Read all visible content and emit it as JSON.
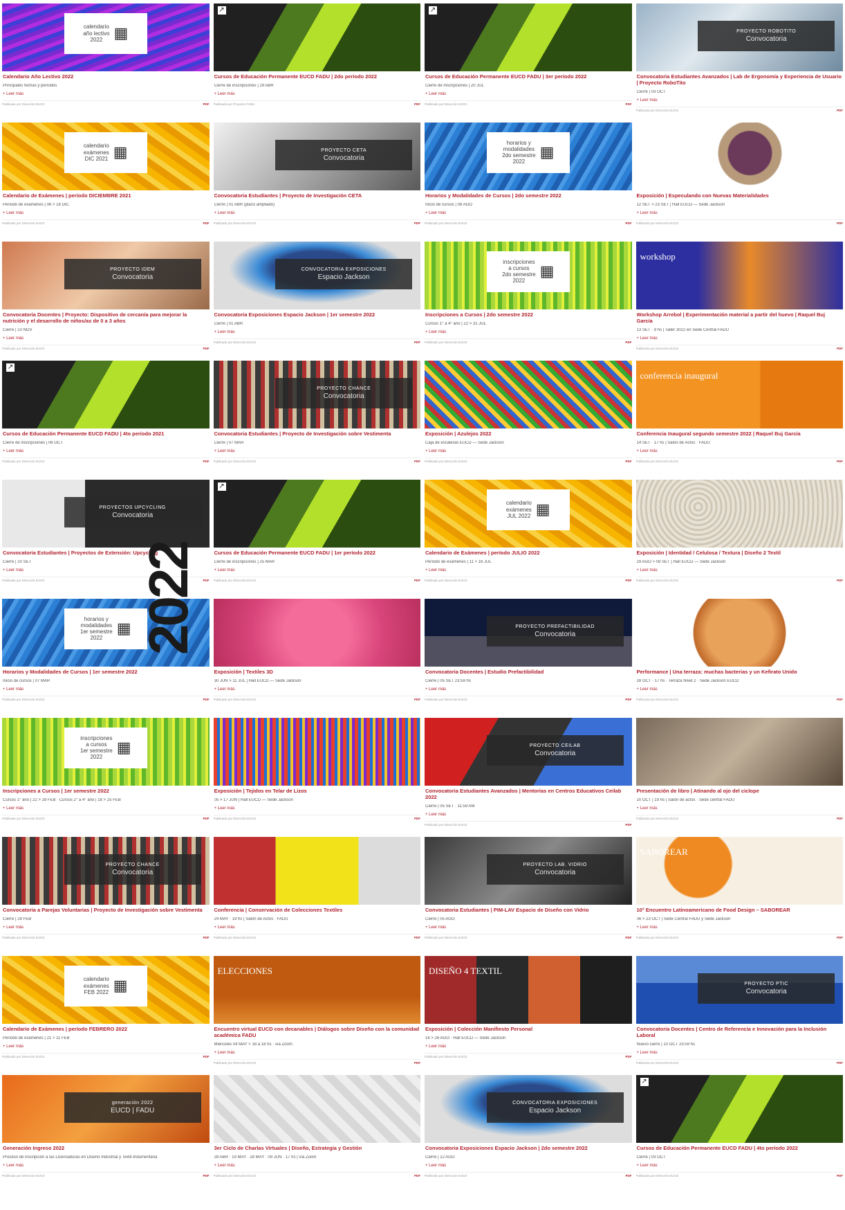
{
  "year_label": "2022",
  "columns": [
    [
      {
        "theme": "t-purple",
        "box": "calendario\naño lectivo\n2022",
        "title": "Calendario Año Lectivo 2022",
        "sub": "Principales fechas y períodos",
        "more": "+ Leer más",
        "meta": "Publicado por Dirección EUCD"
      },
      {
        "theme": "t-yellow",
        "box": "calendario\nexámenes\nDIC 2021",
        "title": "Calendario de Exámenes | período DICIEMBRE 2021",
        "sub": "Período de exámenes | 06 > 18 DIC",
        "more": "+ Leer más",
        "meta": "Publicado por Dirección EUCD"
      },
      {
        "theme": "t-idem",
        "bar": "PROYECTO IDEM",
        "bar2": "Convocatoria",
        "title": "Convocatoria Docentes | Proyecto: Dispositivo de cercanía para mejorar la nutrición y el desarrollo de niños/as de 0 a 3 años",
        "sub": "Cierre | 10 NOV",
        "more": "+ Leer más",
        "meta": "Publicado por Dirección EUCD"
      },
      {
        "theme": "t-green",
        "corner": true,
        "title": "Cursos de Educación Permanente EUCD FADU | 4to período 2021",
        "sub": "Cierre de inscripciones | 06 OCT",
        "more": "+ Leer más",
        "meta": "Publicado por Dirección EUCD"
      },
      {
        "theme": "t-upcycling",
        "bar": "PROYECTOS UPCYCLING",
        "bar2": "Convocatoria",
        "title": "Convocatoria Estudiantes | Proyectos de Extensión: Upcycling",
        "sub": "Cierre | 20 SET",
        "more": "+ Leer más",
        "meta": "Publicado por Dirección EUCD"
      },
      {
        "theme": "t-blue",
        "box": "horarios y\nmodalidades\n1er semestre\n2022",
        "title": "Horarios y Modalidades de Cursos | 1er semestre 2022",
        "sub": "Inicio de cursos | 07 MAR",
        "more": "+ Leer más",
        "meta": "Publicado por Dirección EUCD"
      },
      {
        "theme": "t-lime",
        "box": "inscripciones\na cursos\n1er semestre\n2022",
        "title": "Inscripciones a Cursos | 1er semestre 2022",
        "sub": "Cursos 1° año | 22 > 28 FEB · Cursos 2° a 4° año | 18 > 25 FEB",
        "more": "+ Leer más",
        "meta": "Publicado por Dirección EUCD"
      },
      {
        "theme": "t-clothes",
        "bar": "PROYECTO CHANCE",
        "bar2": "Convocatoria",
        "title": "Convocatoria a Parejas Voluntarias | Proyecto de Investigación sobre Vestimenta",
        "sub": "Cierre | 28 FEB",
        "more": "+ Leer más",
        "meta": "Publicado por Dirección EUCD"
      },
      {
        "theme": "t-yellow",
        "box": "calendario\nexámenes\nFEB 2022",
        "title": "Calendario de Exámenes | período FEBRERO 2022",
        "sub": "Período de exámenes | 21 > 11 FEB",
        "more": "+ Leer más",
        "meta": "Publicado por Dirección EUCD"
      },
      {
        "theme": "t-gen",
        "bar": "generación 2022",
        "bar2": "EUCD | FADU",
        "title": "Generación Ingreso 2022",
        "sub": "Proceso de inscripción a las Licenciaturas en Diseño Industrial y Textil-Indumentaria",
        "more": "+ Leer más",
        "meta": "Publicado por Dirección EUCD"
      }
    ],
    [
      {
        "theme": "t-green",
        "corner": true,
        "title": "Cursos de Educación Permanente EUCD FADU | 2do período 2022",
        "sub": "Cierre de inscripciones | 29 ABR",
        "more": "+ Leer más",
        "meta": "Publicado por Proyecto FADU"
      },
      {
        "theme": "t-ceta",
        "bar": "PROYECTO CETA",
        "bar2": "Convocatoria",
        "title": "Convocatoria Estudiantes | Proyecto de Investigación CETA",
        "sub": "Cierre | 01 ABR (plazo ampliado)",
        "more": "+ Leer más",
        "meta": "Publicado por Dirección EUCD"
      },
      {
        "theme": "t-glass",
        "bar": "CONVOCATORIA EXPOSICIONES",
        "bar2": "Espacio Jackson",
        "title": "Convocatoria Exposiciones Espacio Jackson | 1er semestre 2022",
        "sub": "Cierre | 01 ABR",
        "more": "+ Leer más",
        "meta": "Publicado por Dirección EUCD"
      },
      {
        "theme": "t-clothes",
        "bar": "PROYECTO CHANCE",
        "bar2": "Convocatoria",
        "title": "Convocatoria Estudiantes | Proyecto de Investigación sobre Vestimenta",
        "sub": "Cierre | 07 MAR",
        "more": "+ Leer más",
        "meta": "Publicado por Dirección EUCD"
      },
      {
        "theme": "t-green",
        "corner": true,
        "title": "Cursos de Educación Permanente EUCD FADU | 1er período 2022",
        "sub": "Cierre de inscripciones | 25 MAR",
        "more": "+ Leer más",
        "meta": "Publicado por Dirección EUCD"
      },
      {
        "theme": "t-pink",
        "title": "Exposición | Textiles 3D",
        "sub": "30 JUN > 11 JUL | Hall EUCD — Sede Jackson",
        "more": "+ Leer más",
        "meta": "Publicado por Dirección EUCD"
      },
      {
        "theme": "t-weave",
        "title": "Exposición | Tejidos en Telar de Lizos",
        "sub": "05 > 17 JUN | Hall EUCD — Sede Jackson",
        "more": "+ Leer más",
        "meta": "Publicado por Dirección EUCD"
      },
      {
        "theme": "t-textiles",
        "title": "Conferencia | Conservación de Colecciones Textiles",
        "sub": "24 MAY · 19 hs | Salón de Actos · FADU",
        "more": "+ Leer más",
        "meta": "Publicado por Dirección EUCD"
      },
      {
        "theme": "t-elecc",
        "big": "ELECCIONES",
        "title": "Encuentro virtual EUCD con decanables | Diálogos sobre Diseño con la comunidad académica FADU",
        "sub": "Miércoles 04 MAY > 18 a 18 hs · vía Zoom",
        "more": "+ Leer más",
        "meta": "Publicado por Dirección EUCD"
      },
      {
        "theme": "t-puzzle",
        "title": "3er Ciclo de Charlas Virtuales | Diseño, Estrategia y Gestión",
        "sub": "28 ABR · 19 MAY · 28 MAY · 09 JUN · 17 hs | vía Zoom",
        "more": "+ Leer más",
        "meta": "Publicado por Dirección EUCD"
      }
    ],
    [
      {
        "theme": "t-green",
        "corner": true,
        "title": "Cursos de Educación Permanente EUCD FADU | 3er período 2022",
        "sub": "Cierre de inscripciones | 20 JUL",
        "more": "+ Leer más",
        "meta": "Publicado por Dirección EUCD"
      },
      {
        "theme": "t-blue",
        "box": "horarios y\nmodalidades\n2do semestre\n2022",
        "title": "Horarios y Modalidades de Cursos | 2do semestre 2022",
        "sub": "Inicio de cursos | 08 AGO",
        "more": "+ Leer más",
        "meta": "Publicado por Dirección EUCD"
      },
      {
        "theme": "t-lime",
        "box": "inscripciones\na cursos\n2do semestre\n2022",
        "title": "Inscripciones a Cursos | 2do semestre 2022",
        "sub": "Cursos 1° a 4° año | 22 > 31 JUL",
        "more": "+ Leer más",
        "meta": "Publicado por Dirección EUCD"
      },
      {
        "theme": "t-tiles",
        "title": "Exposición | Azulejos 2022",
        "sub": "Caja de escaleras EUCD — Sede Jackson",
        "more": "+ Leer más",
        "meta": "Publicado por Dirección EUCD"
      },
      {
        "theme": "t-yellow",
        "box": "calendario\nexámenes\nJUL 2022",
        "title": "Calendario de Exámenes | período JULIO 2022",
        "sub": "Período de exámenes | 11 > 16 JUL",
        "more": "+ Leer más",
        "meta": "Publicado por Dirección EUCD"
      },
      {
        "theme": "t-night",
        "bar": "PROYECTO PREFACTIBILIDAD",
        "bar2": "Convocatoria",
        "title": "Convocatoria Docentes | Estudio Prefactibilidad",
        "sub": "Cierre | 05 SET 23:59 hs",
        "more": "+ Leer más",
        "meta": "Publicado por Dirección EUCD"
      },
      {
        "theme": "t-tape",
        "bar": "PROYECTO CEILAB",
        "bar2": "Convocatoria",
        "title": "Convocatoria Estudiantes Avanzados | Mentorías en Centros Educativos Ceilab 2022",
        "sub": "Cierre | 05 SET · 11:59 AM",
        "more": "+ Leer más",
        "meta": "Publicado por Dirección EUCD"
      },
      {
        "theme": "t-vidrio",
        "bar": "PROYECTO LAB. VIDRIO",
        "bar2": "Convocatoria",
        "title": "Convocatoria Estudiantes | PIM-LAV Espacio de Diseño con Vidrio",
        "sub": "Cierre | 05 AGO",
        "more": "+ Leer más",
        "meta": "Publicado por Dirección EUCD"
      },
      {
        "theme": "t-diseno",
        "big": "DISEÑO 4 TEXTIL",
        "title": "Exposición | Colección Manifiesto Personal",
        "sub": "16 > 26 AGO · Hall EUCD — Sede Jackson",
        "more": "+ Leer más",
        "meta": "Publicado por Dirección EUCD"
      },
      {
        "theme": "t-glass",
        "bar": "CONVOCATORIA EXPOSICIONES",
        "bar2": "Espacio Jackson",
        "title": "Convocatoria Exposiciones Espacio Jackson | 2do semestre 2022",
        "sub": "Cierre | 12 AGO",
        "more": "+ Leer más",
        "meta": "Publicado por Dirección EUCD"
      }
    ],
    [
      {
        "theme": "t-robots",
        "bar": "PROYECTO ROBOTITO",
        "bar2": "Convocatoria",
        "title": "Convocatoria Estudiantes Avanzados | Lab de Ergonomía y Experiencia de Usuario | Proyecto RoboTito",
        "sub": "Cierre | 03 OCT",
        "more": "+ Leer más",
        "meta": "Publicado por Dirección EUCD"
      },
      {
        "theme": "t-flowers",
        "title": "Exposición | Especulando con Nuevas Materialidades",
        "sub": "12 SET > 23 SET | Hall EUCD — Sede Jackson",
        "more": "+ Leer más",
        "meta": "Publicado por Dirección EUCD"
      },
      {
        "theme": "t-workshop",
        "big": "workshop",
        "title": "Workshop Arrebol | Experimentación material a partir del huevo | Raquel Buj García",
        "sub": "13 SET · 9 hs | Taller 3022 en Sede Central FADU",
        "more": "+ Leer más",
        "meta": "Publicado por Dirección EUCD"
      },
      {
        "theme": "t-orange",
        "big": "conferencia inaugural",
        "title": "Conferencia Inaugural segundo semestre 2022 | Raquel Buj García",
        "sub": "14 SET · 17 hs | Salón de Actos · FADU",
        "more": "+ Leer más",
        "meta": "Publicado por Dirección EUCD"
      },
      {
        "theme": "t-rope",
        "title": "Exposición | Identidad / Celulosa / Textura | Diseño 2 Textil",
        "sub": "29 AGO > 09 SET | Hall EUCD — Sede Jackson",
        "more": "+ Leer más",
        "meta": "Publicado por Dirección EUCD"
      },
      {
        "theme": "t-bacteria",
        "title": "Performance | Una terraza: muchas bacterias y un Kefirato Unido",
        "sub": "28 OCT · 17 hs · Terraza Nivel 2 · Sede Jackson EUCD",
        "more": "+ Leer más",
        "meta": "Publicado por Dirección EUCD"
      },
      {
        "theme": "t-people",
        "title": "Presentación de libro | Atinando al ojo del ciclope",
        "sub": "20 OCT | 19 hs | Salón de actos · Sede central FADU",
        "more": "+ Leer más",
        "meta": "Publicado por Dirección EUCD"
      },
      {
        "theme": "t-food",
        "big": "SABOREAR",
        "title": "10° Encuentro Latinoamericano de Food Design – SABOREAR",
        "sub": "06 > 23 OCT | Sede Central FADU y Sede Jackson",
        "more": "+ Leer más",
        "meta": "Publicado por Dirección EUCD"
      },
      {
        "theme": "t-pti",
        "bar": "PROYECTO PTIC",
        "bar2": "Convocatoria",
        "title": "Convocatoria Docentes | Centro de Referencia e Innovación para la Inclusión Laboral",
        "sub": "Nuevo cierre | 10 OCT 23:59 hs",
        "more": "+ Leer más",
        "meta": "Publicado por Dirección EUCD"
      },
      {
        "theme": "t-green",
        "corner": true,
        "title": "Cursos de Educación Permanente EUCD FADU | 4to período 2022",
        "sub": "Cierre | 03 OCT",
        "more": "+ Leer más",
        "meta": "Publicado por Dirección EUCD"
      }
    ]
  ],
  "pdf_label": "PDF"
}
